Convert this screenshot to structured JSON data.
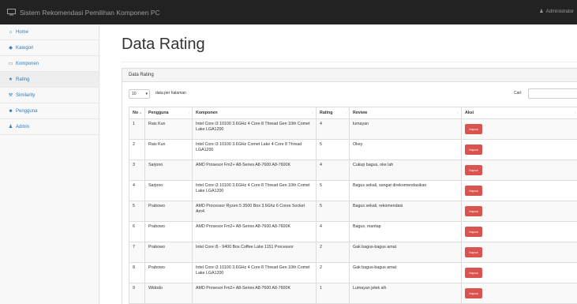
{
  "navbar": {
    "brand": "Sistem Rekomendasi Pemilihan Komponen PC",
    "user_label": "Administrator"
  },
  "sidebar": {
    "items": [
      {
        "label": "Home",
        "icon": "home-icon",
        "glyph": "⌂"
      },
      {
        "label": "Kategori",
        "icon": "tag-icon",
        "glyph": "◆"
      },
      {
        "label": "Komponen",
        "icon": "monitor-icon",
        "glyph": "▭"
      },
      {
        "label": "Rating",
        "icon": "star-icon",
        "glyph": "★"
      },
      {
        "label": "Similarity",
        "icon": "wrench-icon",
        "glyph": "⚒"
      },
      {
        "label": "Pengguna",
        "icon": "users-icon",
        "glyph": "☻"
      },
      {
        "label": "Admin",
        "icon": "user-icon",
        "glyph": "♟"
      }
    ]
  },
  "page": {
    "title": "Data Rating",
    "panel_heading": "Data Rating",
    "length_value": "10",
    "length_label": "data per halaman",
    "search_label": "Cari:",
    "search_value": ""
  },
  "table": {
    "headers": [
      "No",
      "Pengguna",
      "Komponen",
      "Rating",
      "Review",
      "Aksi"
    ],
    "delete_label": "Hapus",
    "rows": [
      {
        "no": "1",
        "pengguna": "Rais Kun",
        "komponen": "Intel Core i3 10100 3.6GHz 4 Core 8 Thread Gen 10th Comet Lake LGA1200",
        "rating": "4",
        "review": "lumayan"
      },
      {
        "no": "2",
        "pengguna": "Rais Kun",
        "komponen": "Intel Core i3 10100 3.6GHz Comet Lake 4 Core 8 Thread LGA1200",
        "rating": "5",
        "review": "Okey"
      },
      {
        "no": "3",
        "pengguna": "Sarjono",
        "komponen": "AMD Prosesor Fm2+ A8-Series A8-7600 A8-7600K",
        "rating": "4",
        "review": "Cukup bagus, oke lah"
      },
      {
        "no": "4",
        "pengguna": "Sarjono",
        "komponen": "Intel Core i3 10100 3.6GHz 4 Core 8 Thread Gen 10th Comet Lake LGA1200",
        "rating": "5",
        "review": "Bagus sekali, sangat direkomendasikan"
      },
      {
        "no": "5",
        "pengguna": "Prabowo",
        "komponen": "AMD Processor Ryzen 5 3500 Box 3.6Ghz 6 Cores Socket Am4",
        "rating": "5",
        "review": "Bagus sekali, rekomendasi"
      },
      {
        "no": "6",
        "pengguna": "Prabowo",
        "komponen": "AMD Prosesor Fm2+ A8-Series A8-7600 A8-7600K",
        "rating": "4",
        "review": "Bagus, mantap"
      },
      {
        "no": "7",
        "pengguna": "Prabowo",
        "komponen": "Intel Core i5 - 9400 Box Coffee Lake 1151 Processor",
        "rating": "2",
        "review": "Gak bagus-bagus amat"
      },
      {
        "no": "8",
        "pengguna": "Prabowo",
        "komponen": "Intel Core i3 10100 3.6GHz 4 Core 8 Thread Gen 10th Comet Lake LGA1200",
        "rating": "2",
        "review": "Gak bagus-bagus amat"
      },
      {
        "no": "9",
        "pengguna": "Widodo",
        "komponen": "AMD Prosesor Fm2+ A8-Series A8-7600 A8-7600K",
        "rating": "1",
        "review": "Lumayan jelek sih"
      }
    ]
  },
  "colors": {
    "navbar_bg": "#222222",
    "link": "#337ab7",
    "danger": "#d9534f"
  }
}
